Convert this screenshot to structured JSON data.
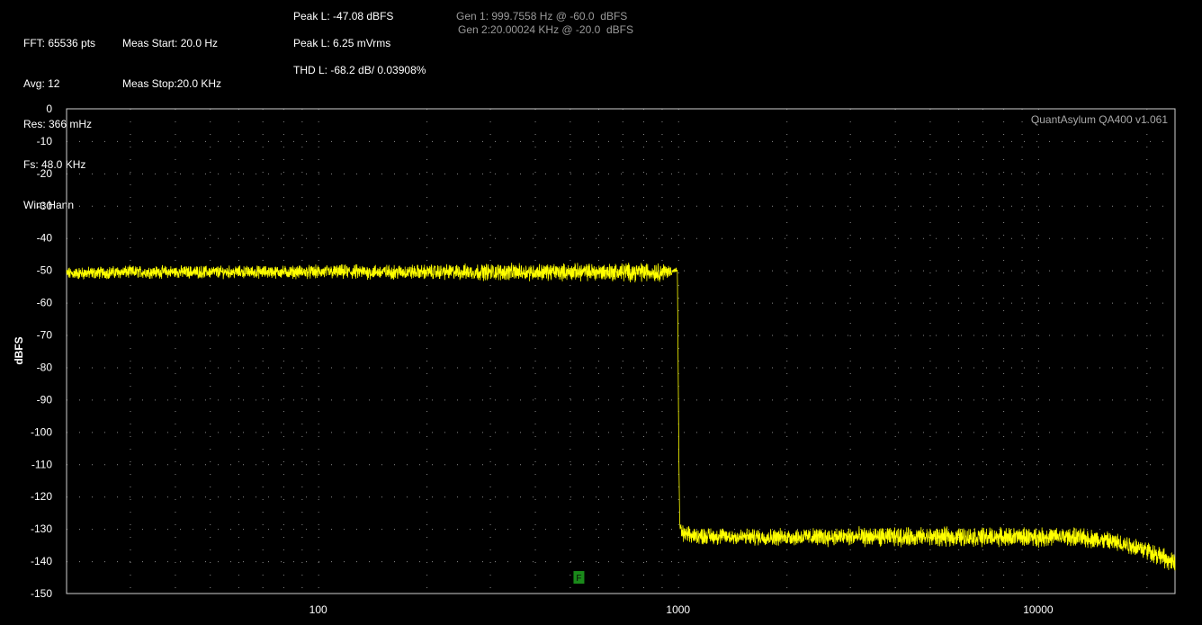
{
  "header": {
    "col1": [
      "FFT: 65536 pts",
      "Avg: 12",
      "Res: 366 mHz",
      "Fs: 48.0 KHz",
      "Win: Hann"
    ],
    "col2": [
      "Meas Start: 20.0 Hz",
      "Meas Stop:20.0 KHz"
    ],
    "peak_db": "Peak L: -47.08 dBFS",
    "peak_v": "Peak L: 6.25 mVrms",
    "thd": "THD L: -68.2 dB/ 0.03908%",
    "gen1": "Gen 1: 999.7558 Hz @ -60.0  dBFS",
    "gen2": "Gen 2:20.00024 KHz @ -20.0  dBFS"
  },
  "chart_data": {
    "type": "line",
    "watermark": "QuantAsylum QA400 v1.061",
    "xlabel": "",
    "ylabel": "dBFS",
    "x_scale": "log",
    "xlim": [
      20,
      24000
    ],
    "ylim": [
      -150,
      0
    ],
    "x_ticks": [
      100,
      1000,
      10000
    ],
    "x_tick_labels": [
      "100",
      "1000",
      "10000"
    ],
    "y_ticks": [
      0,
      -10,
      -20,
      -30,
      -40,
      -50,
      -60,
      -70,
      -80,
      -90,
      -100,
      -110,
      -120,
      -130,
      -140,
      -150
    ],
    "grid": true,
    "marker": {
      "label": "F",
      "x": 530,
      "y": -145
    },
    "series": [
      {
        "color": "#ffff00",
        "x": [
          20,
          30,
          50,
          80,
          120,
          200,
          300,
          500,
          700,
          900,
          995,
          1000,
          1005,
          1010,
          1020,
          1050,
          1500,
          2000,
          3000,
          5000,
          8000,
          10000,
          12000,
          14000,
          16000,
          18000,
          20000,
          22000,
          24000
        ],
        "y": [
          -51,
          -50.5,
          -50.5,
          -50.5,
          -50.5,
          -50.5,
          -50.5,
          -50.5,
          -50.5,
          -50.5,
          -50,
          -80,
          -110,
          -128,
          -131,
          -132,
          -132.5,
          -132.5,
          -132.5,
          -132.5,
          -132.5,
          -132.5,
          -132.5,
          -133,
          -134,
          -135,
          -136.5,
          -138.5,
          -141
        ],
        "noise_db": [
          3,
          3,
          3,
          3,
          3.5,
          3.5,
          4,
          4,
          4.5,
          4.5,
          1,
          0,
          0,
          1,
          4,
          4,
          4,
          4,
          4.5,
          4.5,
          4.5,
          4.5,
          4.5,
          4.5,
          4.5,
          4.5,
          4.5,
          4.5,
          4.5
        ]
      }
    ]
  }
}
